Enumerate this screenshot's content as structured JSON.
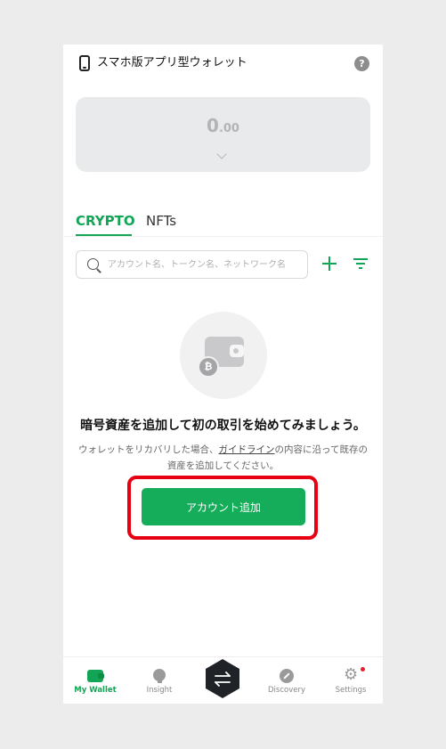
{
  "header": {
    "title": "スマホ版アプリ型ウォレット",
    "help_icon": "?"
  },
  "balance": {
    "integer": "0",
    "decimal": ".00"
  },
  "tabs": [
    {
      "label": "CRYPTO",
      "active": true
    },
    {
      "label": "NFTs",
      "active": false
    }
  ],
  "search": {
    "placeholder": "アカウント名、トークン名、ネットワーク名"
  },
  "empty_state": {
    "coin_symbol": "₿",
    "headline": "暗号資産を追加して初の取引を始めてみましょう。",
    "desc_before_link": "ウォレットをリカバリした場合、",
    "desc_link": "ガイドライン",
    "desc_after_link": "の内容に沿って既存の資産を追加してください。",
    "button_label": "アカウント追加"
  },
  "bottom_nav": {
    "items": [
      {
        "label": "My Wallet",
        "icon": "wallet-icon",
        "active": true
      },
      {
        "label": "Insight",
        "icon": "lightbulb-icon",
        "active": false
      },
      {
        "label": "Discovery",
        "icon": "compass-icon",
        "active": false
      },
      {
        "label": "Settings",
        "icon": "gear-icon",
        "active": false
      }
    ],
    "swap_icon": "swap-arrows-icon"
  },
  "colors": {
    "accent": "#13a556",
    "highlight": "#e60012"
  }
}
